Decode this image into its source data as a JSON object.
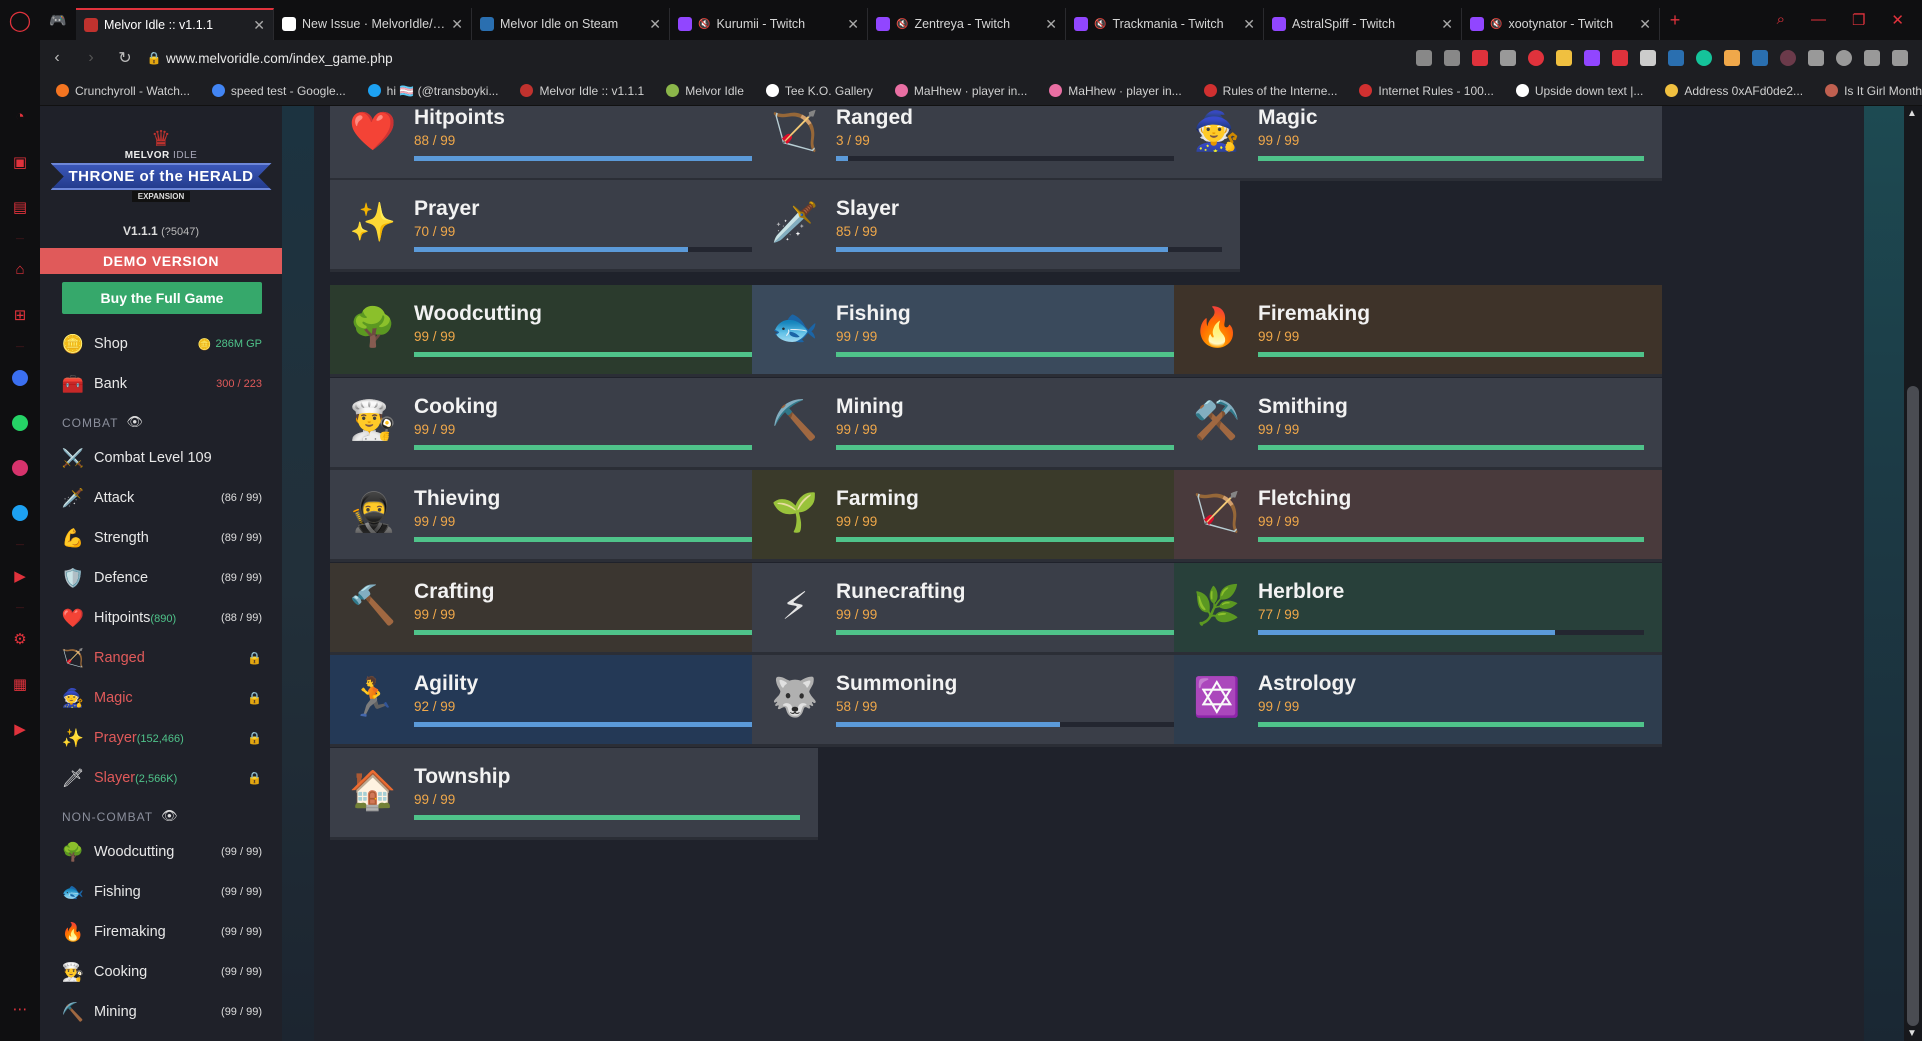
{
  "browser": {
    "tabs": [
      {
        "title": "Melvor Idle :: v1.1.1",
        "active": true,
        "fav": "#c0322e"
      },
      {
        "title": "New Issue · MelvorIdle/melvo",
        "fav": "#ffffff"
      },
      {
        "title": "Melvor Idle on Steam",
        "fav": "#2a6fb0"
      },
      {
        "title": "Kurumii - Twitch",
        "fav": "#9146ff",
        "muted": true
      },
      {
        "title": "Zentreya - Twitch",
        "fav": "#9146ff",
        "muted": true
      },
      {
        "title": "Trackmania - Twitch",
        "fav": "#9146ff",
        "muted": true
      },
      {
        "title": "AstralSpiff - Twitch",
        "fav": "#9146ff"
      },
      {
        "title": "xootynator - Twitch",
        "fav": "#9146ff",
        "muted": true
      }
    ],
    "url": "www.melvoridle.com/index_game.php",
    "bookmarks": [
      {
        "title": "Crunchyroll - Watch...",
        "fav": "#f47521"
      },
      {
        "title": "speed test - Google...",
        "fav": "#4285f4"
      },
      {
        "title": "hi 🏳️‍⚧️ (@transboyki...",
        "fav": "#1da1f2"
      },
      {
        "title": "Melvor Idle :: v1.1.1",
        "fav": "#c0322e"
      },
      {
        "title": "Melvor Idle",
        "fav": "#8bb64a"
      },
      {
        "title": "Tee K.O. Gallery",
        "fav": "#ffffff"
      },
      {
        "title": "MaHhew · player in...",
        "fav": "#e96fa3"
      },
      {
        "title": "MaHhew · player in...",
        "fav": "#e96fa3"
      },
      {
        "title": "Rules of the Interne...",
        "fav": "#d03030"
      },
      {
        "title": "Internet Rules - 100...",
        "fav": "#d03030"
      },
      {
        "title": "Upside down text |...",
        "fav": "#ffffff"
      },
      {
        "title": "Address 0xAFd0de2...",
        "fav": "#f0c040"
      },
      {
        "title": "Is It Girl Month?",
        "fav": "#c06050"
      }
    ]
  },
  "sidebar": {
    "brand": "MELVOR",
    "brand_sub": "IDLE",
    "banner": "THRONE of the HERALD",
    "expansion": "EXPANSION",
    "version": "V1.1.1",
    "build": "(?5047)",
    "demo_label": "DEMO VERSION",
    "buy_label": "Buy the Full Game",
    "shop": {
      "label": "Shop",
      "value": "286M GP"
    },
    "bank": {
      "label": "Bank",
      "value": "300 / 223"
    },
    "combat_header": "COMBAT",
    "combat_level": "Combat Level 109",
    "combat": [
      {
        "label": "Attack",
        "extra": "",
        "value": "(86 / 99)",
        "icon": "🗡️",
        "locked": false
      },
      {
        "label": "Strength",
        "extra": "",
        "value": "(89 / 99)",
        "icon": "💪",
        "locked": false
      },
      {
        "label": "Defence",
        "extra": "",
        "value": "(89 / 99)",
        "icon": "🛡️",
        "locked": false
      },
      {
        "label": "Hitpoints",
        "extra": "(890)",
        "value": "(88 / 99)",
        "icon": "❤️",
        "locked": false
      },
      {
        "label": "Ranged",
        "extra": "",
        "value": "",
        "icon": "🏹",
        "locked": true
      },
      {
        "label": "Magic",
        "extra": "",
        "value": "",
        "icon": "🧙",
        "locked": true
      },
      {
        "label": "Prayer",
        "extra": "(152,466)",
        "value": "",
        "icon": "✨",
        "locked": true
      },
      {
        "label": "Slayer",
        "extra": "(2,566K)",
        "value": "",
        "icon": "🗡",
        "locked": true
      }
    ],
    "noncombat_header": "NON-COMBAT",
    "noncombat": [
      {
        "label": "Woodcutting",
        "value": "(99 / 99)",
        "icon": "🌳"
      },
      {
        "label": "Fishing",
        "value": "(99 / 99)",
        "icon": "🐟"
      },
      {
        "label": "Firemaking",
        "value": "(99 / 99)",
        "icon": "🔥"
      },
      {
        "label": "Cooking",
        "value": "(99 / 99)",
        "icon": "👨‍🍳"
      },
      {
        "label": "Mining",
        "value": "(99 / 99)",
        "icon": "⛏️"
      }
    ]
  },
  "skills": [
    {
      "name": "Hitpoints",
      "level": "88 / 99",
      "progress": 0.9,
      "color": "blue",
      "icon": "❤️",
      "theme": ""
    },
    {
      "name": "Ranged",
      "level": "3 / 99",
      "progress": 0.03,
      "color": "blue",
      "icon": "🏹",
      "theme": ""
    },
    {
      "name": "Magic",
      "level": "99 / 99",
      "progress": 1.0,
      "color": "green",
      "icon": "🧙",
      "theme": ""
    },
    {
      "name": "Prayer",
      "level": "70 / 99",
      "progress": 0.71,
      "color": "blue",
      "icon": "✨",
      "theme": ""
    },
    {
      "name": "Slayer",
      "level": "85 / 99",
      "progress": 0.86,
      "color": "blue",
      "icon": "🗡️",
      "theme": ""
    },
    {
      "name": "Woodcutting",
      "level": "99 / 99",
      "progress": 1.0,
      "color": "green",
      "icon": "🌳",
      "theme": "c-wood"
    },
    {
      "name": "Fishing",
      "level": "99 / 99",
      "progress": 1.0,
      "color": "green",
      "icon": "🐟",
      "theme": "c-fish"
    },
    {
      "name": "Firemaking",
      "level": "99 / 99",
      "progress": 1.0,
      "color": "green",
      "icon": "🔥",
      "theme": "c-fire"
    },
    {
      "name": "Cooking",
      "level": "99 / 99",
      "progress": 1.0,
      "color": "green",
      "icon": "👨‍🍳",
      "theme": ""
    },
    {
      "name": "Mining",
      "level": "99 / 99",
      "progress": 1.0,
      "color": "green",
      "icon": "⛏️",
      "theme": ""
    },
    {
      "name": "Smithing",
      "level": "99 / 99",
      "progress": 1.0,
      "color": "green",
      "icon": "⚒️",
      "theme": ""
    },
    {
      "name": "Thieving",
      "level": "99 / 99",
      "progress": 1.0,
      "color": "green",
      "icon": "🥷",
      "theme": ""
    },
    {
      "name": "Farming",
      "level": "99 / 99",
      "progress": 1.0,
      "color": "green",
      "icon": "🌱",
      "theme": "c-farm"
    },
    {
      "name": "Fletching",
      "level": "99 / 99",
      "progress": 1.0,
      "color": "green",
      "icon": "🏹",
      "theme": "c-flet"
    },
    {
      "name": "Crafting",
      "level": "99 / 99",
      "progress": 1.0,
      "color": "green",
      "icon": "🔨",
      "theme": "c-craft"
    },
    {
      "name": "Runecrafting",
      "level": "99 / 99",
      "progress": 1.0,
      "color": "green",
      "icon": "⚡",
      "theme": ""
    },
    {
      "name": "Herblore",
      "level": "77 / 99",
      "progress": 0.77,
      "color": "blue",
      "icon": "🌿",
      "theme": "c-herb"
    },
    {
      "name": "Agility",
      "level": "92 / 99",
      "progress": 0.93,
      "color": "blue",
      "icon": "🏃",
      "theme": "c-agil"
    },
    {
      "name": "Summoning",
      "level": "58 / 99",
      "progress": 0.58,
      "color": "blue",
      "icon": "🐺",
      "theme": ""
    },
    {
      "name": "Astrology",
      "level": "99 / 99",
      "progress": 1.0,
      "color": "green",
      "icon": "✡️",
      "theme": "c-astr"
    },
    {
      "name": "Township",
      "level": "99 / 99",
      "progress": 1.0,
      "color": "green",
      "icon": "🏠",
      "theme": ""
    }
  ]
}
